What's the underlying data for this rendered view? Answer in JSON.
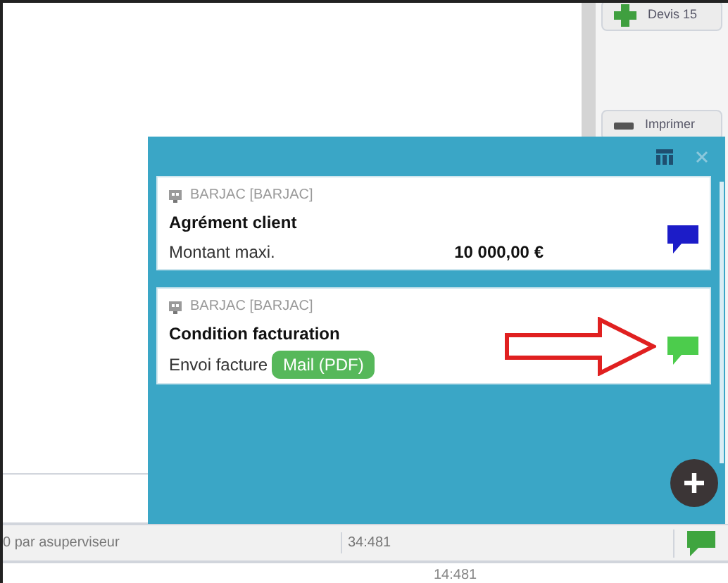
{
  "toolbar_buttons": [
    {
      "label": "Devis 15",
      "kind": "add"
    },
    {
      "label": "Imprimer",
      "kind": "print"
    }
  ],
  "panel": {
    "cards": [
      {
        "company": "BARJAC [BARJAC]",
        "title": "Agrément client",
        "field_label": "Montant maxi.",
        "value": "10 000,00 €",
        "kind": "amount",
        "color": "#1c1cc8"
      },
      {
        "company": "BARJAC [BARJAC]",
        "title": "Condition facturation",
        "field_label": "Envoi facture",
        "value": "Mail (PDF)",
        "kind": "badge",
        "color": "#4ccc4c"
      }
    ]
  },
  "status_bar": {
    "text": "0 par asuperviseur",
    "time": "34:481"
  },
  "footer": {
    "text": "14:481"
  }
}
